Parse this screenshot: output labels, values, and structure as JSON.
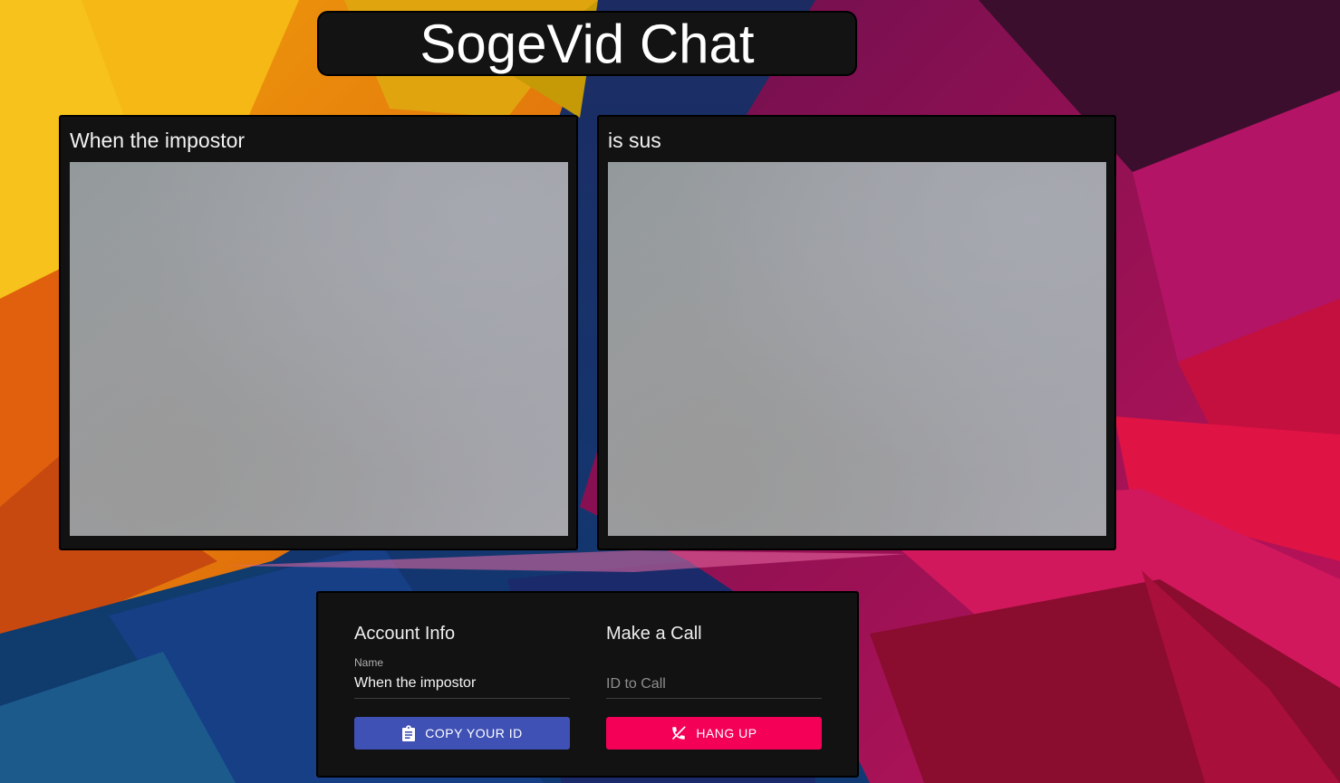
{
  "header": {
    "title": "SogeVid Chat"
  },
  "videos": [
    {
      "name": "When the impostor"
    },
    {
      "name": "is sus"
    }
  ],
  "account": {
    "section_title": "Account Info",
    "name_label": "Name",
    "name_value": "When the impostor",
    "copy_button": {
      "label": "COPY YOUR ID",
      "icon": "clipboard-icon",
      "color": "#3f51b5"
    }
  },
  "call": {
    "section_title": "Make a Call",
    "id_placeholder": "ID to Call",
    "id_value": "",
    "hangup_button": {
      "label": "HANG UP",
      "icon": "phone-disabled-icon",
      "color": "#f50057"
    }
  },
  "theme": {
    "panel_bg": "#121212",
    "text": "#ffffff"
  }
}
